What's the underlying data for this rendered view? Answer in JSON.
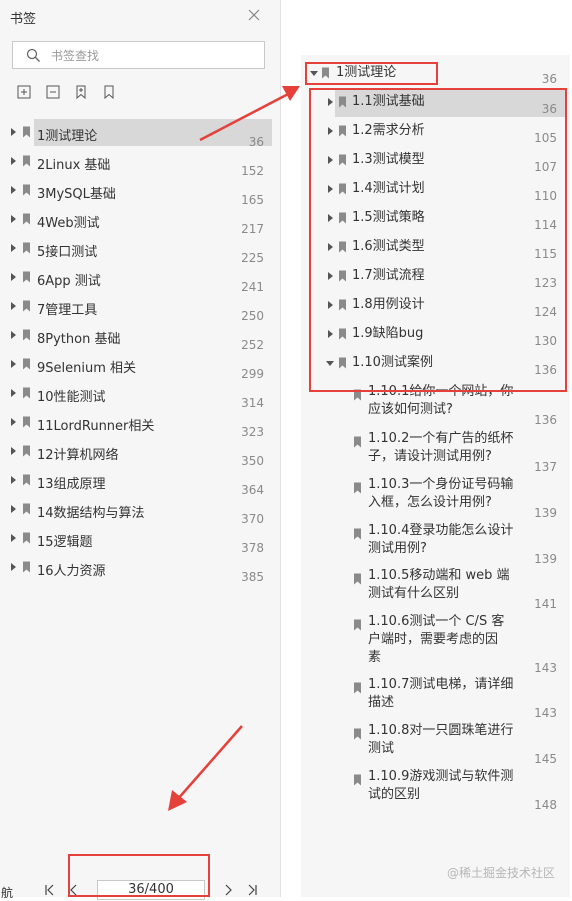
{
  "panel": {
    "title": "书签",
    "search_placeholder": "书签查找"
  },
  "left_bookmarks": [
    {
      "label": "1测试理论",
      "page": "36"
    },
    {
      "label": "2Linux 基础",
      "page": "152"
    },
    {
      "label": "3MySQL基础",
      "page": "165"
    },
    {
      "label": "4Web测试",
      "page": "217"
    },
    {
      "label": "5接口测试",
      "page": "225"
    },
    {
      "label": "6App 测试",
      "page": "241"
    },
    {
      "label": "7管理工具",
      "page": "250"
    },
    {
      "label": "8Python 基础",
      "page": "252"
    },
    {
      "label": "9Selenium 相关",
      "page": "299"
    },
    {
      "label": "10性能测试",
      "page": "314"
    },
    {
      "label": "11LordRunner相关",
      "page": "323"
    },
    {
      "label": "12计算机网络",
      "page": "350"
    },
    {
      "label": "13组成原理",
      "page": "364"
    },
    {
      "label": "14数据结构与算法",
      "page": "370"
    },
    {
      "label": "15逻辑题",
      "page": "378"
    },
    {
      "label": "16人力资源",
      "page": "385"
    }
  ],
  "navigation": {
    "label": "航",
    "page_display": "36/400"
  },
  "right_parent": {
    "label": "1测试理论",
    "page": "36"
  },
  "right_children": [
    {
      "label": "1.1测试基础",
      "page": "36"
    },
    {
      "label": "1.2需求分析",
      "page": "105"
    },
    {
      "label": "1.3测试模型",
      "page": "107"
    },
    {
      "label": "1.4测试计划",
      "page": "110"
    },
    {
      "label": "1.5测试策略",
      "page": "114"
    },
    {
      "label": "1.6测试类型",
      "page": "115"
    },
    {
      "label": "1.7测试流程",
      "page": "123"
    },
    {
      "label": "1.8用例设计",
      "page": "124"
    },
    {
      "label": "1.9缺陷bug",
      "page": "130"
    },
    {
      "label": "1.10测试案例",
      "page": "136"
    }
  ],
  "right_subitems": [
    {
      "lines": [
        "1.10.1给你一个网站，你",
        "应该如何测试?"
      ],
      "page": "136"
    },
    {
      "lines": [
        "1.10.2一个有广告的纸杯",
        "子，请设计测试用例?"
      ],
      "page": "137"
    },
    {
      "lines": [
        "1.10.3一个身份证号码输",
        "入框，怎么设计用例?"
      ],
      "page": "139"
    },
    {
      "lines": [
        "1.10.4登录功能怎么设计",
        "测试用例?"
      ],
      "page": "139"
    },
    {
      "lines": [
        "1.10.5移动端和 web 端",
        "测试有什么区别"
      ],
      "page": "141"
    },
    {
      "lines": [
        "1.10.6测试一个 C/S 客",
        "户端时，需要考虑的因",
        "素"
      ],
      "page": "143"
    },
    {
      "lines": [
        "1.10.7测试电梯，请详细",
        "描述"
      ],
      "page": "143"
    },
    {
      "lines": [
        "1.10.8对一只圆珠笔进行",
        "测试"
      ],
      "page": "145"
    },
    {
      "lines": [
        "1.10.9游戏测试与软件测",
        "试的区别"
      ],
      "page": "148"
    }
  ],
  "watermark": "@稀土掘金技术社区",
  "colors": {
    "highlight_red": "#e6403a",
    "selected_bg": "#d8d8d8",
    "panel_bg": "#f6f6f7"
  }
}
